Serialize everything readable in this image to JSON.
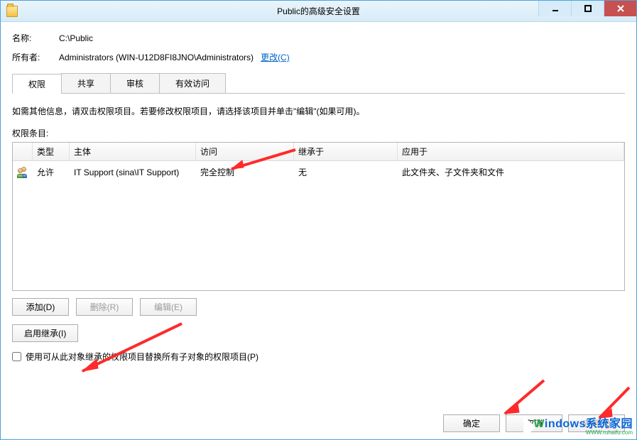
{
  "title": "Public的高级安全设置",
  "fields": {
    "name_label": "名称:",
    "name_value": "C:\\Public",
    "owner_label": "所有者:",
    "owner_value": "Administrators (WIN-U12D8FI8JNO\\Administrators)",
    "change_link": "更改(C)"
  },
  "tabs": {
    "perm": "权限",
    "share": "共享",
    "audit": "审核",
    "effective": "有效访问"
  },
  "instruction": "如需其他信息，请双击权限项目。若要修改权限项目，请选择该项目并单击\"编辑\"(如果可用)。",
  "section_label": "权限条目:",
  "grid": {
    "headers": {
      "type": "类型",
      "principal": "主体",
      "access": "访问",
      "inherit": "继承于",
      "apply": "应用于"
    },
    "rows": [
      {
        "type": "允许",
        "principal": "IT Support (sina\\IT Support)",
        "access": "完全控制",
        "inherit": "无",
        "apply": "此文件夹、子文件夹和文件"
      }
    ]
  },
  "buttons": {
    "add": "添加(D)",
    "remove": "删除(R)",
    "edit": "编辑(E)",
    "enable_inherit": "启用继承(I)",
    "ok": "确定",
    "cancel": "取消",
    "apply": "应用(A)"
  },
  "checkbox": {
    "label": "使用可从此对象继承的权限项目替换所有子对象的权限项目(P)"
  },
  "watermark": {
    "main_w": "W",
    "main_rest": "indows系统家园",
    "sub": "WWW.ruhaifu.com"
  }
}
